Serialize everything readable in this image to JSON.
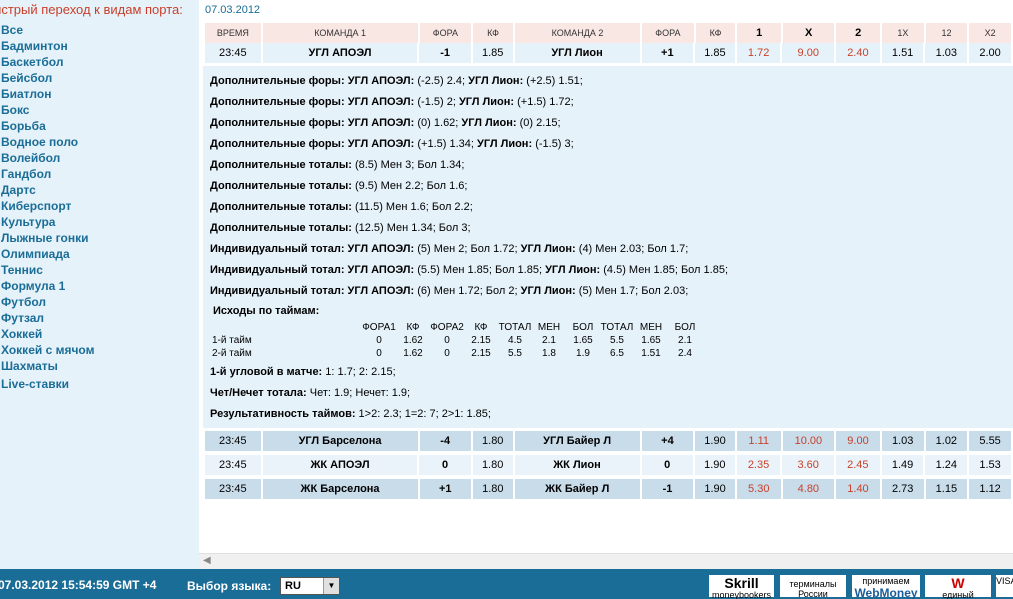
{
  "sidebar": {
    "heading": "ыстрый переход к видам порта:",
    "items": [
      "Все",
      "Бадминтон",
      "Баскетбол",
      "Бейсбол",
      "Биатлон",
      "Бокс",
      "Борьба",
      "Водное поло",
      "Волейбол",
      "Гандбол",
      "Дартс",
      "Киберспорт",
      "Культура",
      "Лыжные гонки",
      "Олимпиада",
      "Теннис",
      "Формула 1",
      "Футбол",
      "Футзал",
      "Хоккей",
      "Хоккей с мячом",
      "Шахматы"
    ],
    "live": "Live-ставки"
  },
  "main": {
    "date": "07.03.2012",
    "columns": [
      "ВРЕМЯ",
      "КОМАНДА 1",
      "ФОРА",
      "КФ",
      "КОМАНДА 2",
      "ФОРА",
      "КФ",
      "1",
      "X",
      "2",
      "1X",
      "12",
      "X2"
    ],
    "first_match": [
      "23:45",
      "УГЛ АПОЭЛ",
      "-1",
      "1.85",
      "УГЛ Лион",
      "+1",
      "1.85",
      "1.72",
      "9.00",
      "2.40",
      "1.51",
      "1.03",
      "2.00"
    ],
    "details": [
      {
        "label": "Дополнительные форы:",
        "t1": "УГЛ АПОЭЛ:",
        "v1": "(-2.5) 2.4;",
        "t2": "УГЛ Лион:",
        "v2": "(+2.5) 1.51;"
      },
      {
        "label": "Дополнительные форы:",
        "t1": "УГЛ АПОЭЛ:",
        "v1": "(-1.5) 2;",
        "t2": "УГЛ Лион:",
        "v2": "(+1.5) 1.72;"
      },
      {
        "label": "Дополнительные форы:",
        "t1": "УГЛ АПОЭЛ:",
        "v1": "(0) 1.62;",
        "t2": "УГЛ Лион:",
        "v2": "(0) 2.15;"
      },
      {
        "label": "Дополнительные форы:",
        "t1": "УГЛ АПОЭЛ:",
        "v1": "(+1.5) 1.34;",
        "t2": "УГЛ Лион:",
        "v2": "(-1.5) 3;"
      },
      {
        "label": "Дополнительные тоталы:",
        "t1": "",
        "v1": "(8.5) Мен 3; Бол 1.34;",
        "t2": "",
        "v2": ""
      },
      {
        "label": "Дополнительные тоталы:",
        "t1": "",
        "v1": "(9.5) Мен 2.2; Бол 1.6;",
        "t2": "",
        "v2": ""
      },
      {
        "label": "Дополнительные тоталы:",
        "t1": "",
        "v1": "(11.5) Мен 1.6; Бол 2.2;",
        "t2": "",
        "v2": ""
      },
      {
        "label": "Дополнительные тоталы:",
        "t1": "",
        "v1": "(12.5) Мен 1.34; Бол 3;",
        "t2": "",
        "v2": ""
      },
      {
        "label": "Индивидуальный тотал:",
        "t1": "УГЛ АПОЭЛ:",
        "v1": "(5) Мен 2; Бол 1.72;",
        "t2": "УГЛ Лион:",
        "v2": "(4) Мен 2.03; Бол 1.7;"
      },
      {
        "label": "Индивидуальный тотал:",
        "t1": "УГЛ АПОЭЛ:",
        "v1": "(5.5) Мен 1.85; Бол 1.85;",
        "t2": "УГЛ Лион:",
        "v2": "(4.5) Мен 1.85; Бол 1.85;"
      },
      {
        "label": "Индивидуальный тотал:",
        "t1": "УГЛ АПОЭЛ:",
        "v1": "(6) Мен 1.72; Бол 2;",
        "t2": "УГЛ Лион:",
        "v2": "(5) Мен 1.7; Бол 2.03;"
      }
    ],
    "halves": {
      "title": "Исходы по таймам:",
      "headers": [
        "ФОРА1",
        "КФ",
        "ФОРА2",
        "КФ",
        "ТОТАЛ",
        "МЕН",
        "БОЛ",
        "ТОТАЛ",
        "МЕН",
        "БОЛ"
      ],
      "rows": [
        {
          "label": "1-й тайм",
          "values": [
            "0",
            "1.62",
            "0",
            "2.15",
            "4.5",
            "2.1",
            "1.65",
            "5.5",
            "1.65",
            "2.1"
          ]
        },
        {
          "label": "2-й тайм",
          "values": [
            "0",
            "1.62",
            "0",
            "2.15",
            "5.5",
            "1.8",
            "1.9",
            "6.5",
            "1.51",
            "2.4"
          ]
        }
      ]
    },
    "extra": [
      {
        "label": "1-й угловой в матче:",
        "value": " 1: 1.7; 2: 2.15;"
      },
      {
        "label": "Чет/Нечет тотала:",
        "value": " Чет: 1.9; Нечет: 1.9;"
      },
      {
        "label": "Результативность таймов:",
        "value": " 1>2: 2.3; 1=2: 7; 2>1: 1.85;"
      }
    ],
    "matches": [
      [
        "23:45",
        "УГЛ Барселона",
        "-4",
        "1.80",
        "УГЛ Байер Л",
        "+4",
        "1.90",
        "1.11",
        "10.00",
        "9.00",
        "1.03",
        "1.02",
        "5.55"
      ],
      [
        "23:45",
        "ЖК АПОЭЛ",
        "0",
        "1.80",
        "ЖК Лион",
        "0",
        "1.90",
        "2.35",
        "3.60",
        "2.45",
        "1.49",
        "1.24",
        "1.53"
      ],
      [
        "23:45",
        "ЖК Барселона",
        "+1",
        "1.80",
        "ЖК Байер Л",
        "-1",
        "1.90",
        "5.30",
        "4.80",
        "1.40",
        "2.73",
        "1.15",
        "1.12"
      ]
    ]
  },
  "footer": {
    "datetime": "07.03.2012  15:54:59  GMT +4",
    "lang_label": "Выбор языка:",
    "lang_value": "RU",
    "payments": [
      {
        "title": "Skrill",
        "sub": "moneybookers"
      },
      {
        "title": "",
        "sub": "терминалы России"
      },
      {
        "title": "WebMoney",
        "sub": "принимаем"
      },
      {
        "title": "",
        "sub": "единый кошелек"
      },
      {
        "title": "",
        "sub": "VISA"
      }
    ]
  },
  "colors": {
    "accent": "#1a6d96",
    "red": "#c8402a",
    "header_bg": "#f9e7e4",
    "row_bg": "#e6f2fa",
    "row_alt": "#c8dcea"
  }
}
